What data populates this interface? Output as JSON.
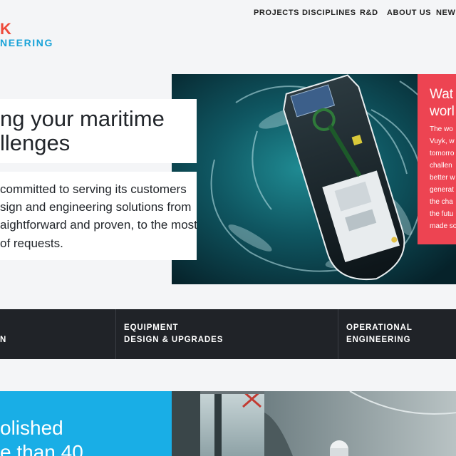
{
  "logo": {
    "top_text": "K",
    "bottom_text": "NEERING"
  },
  "nav": {
    "items": [
      "PROJECTS",
      "DISCIPLINES",
      "R&D",
      "ABOUT US",
      "NEWS"
    ]
  },
  "hero": {
    "title_lines": [
      "ng your maritime",
      "llenges"
    ],
    "body_lines": [
      "committed to serving its customers",
      "sign and engineering solutions from",
      "aightforward and proven, to the most",
      "of requests."
    ]
  },
  "promo": {
    "heading_lines": [
      "Wat",
      "worl"
    ],
    "text_lines": [
      "The wo",
      "Vuyk, w",
      "tomorro",
      "challen",
      "better w",
      "generat",
      "the cha",
      "the futu",
      "made so"
    ]
  },
  "services": {
    "items": [
      {
        "line1": "",
        "line2": "N"
      },
      {
        "line1": "EQUIPMENT",
        "line2": "DESIGN & UPGRADES"
      },
      {
        "line1": "OPERATIONAL",
        "line2": "ENGINEERING"
      }
    ]
  },
  "bottom": {
    "lines": [
      "olished",
      "e than 40"
    ]
  },
  "colors": {
    "accent_red": "#ed4452",
    "accent_blue": "#19aee6",
    "dark_bar": "#202328"
  }
}
